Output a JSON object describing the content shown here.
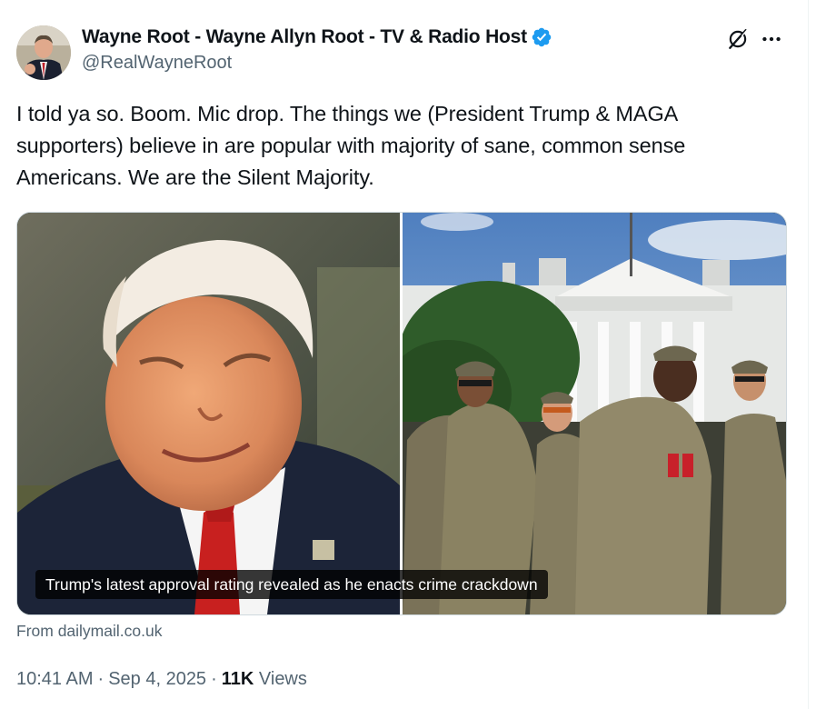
{
  "author": {
    "display_name": "Wayne Root - Wayne Allyn Root - TV & Radio Host",
    "handle": "@RealWayneRoot",
    "verified": true
  },
  "header_icons": [
    "grok-icon",
    "more-icon"
  ],
  "tweet": {
    "text": "I told ya so. Boom. Mic drop. The things we (President Trump & MAGA supporters) believe in are popular with majority of sane, common sense Americans. We are the Silent Majority."
  },
  "link_card": {
    "caption": "Trump's latest approval rating revealed as he enacts crime crackdown",
    "source": "From dailymail.co.uk"
  },
  "meta": {
    "time": "10:41 AM",
    "date": "Sep 4, 2025",
    "views_count": "11K",
    "views_label": "Views",
    "separator": "·"
  },
  "colors": {
    "text_primary": "#0f1419",
    "text_secondary": "#536471",
    "verified_blue": "#1d9bf0",
    "border": "#cfd9de"
  }
}
